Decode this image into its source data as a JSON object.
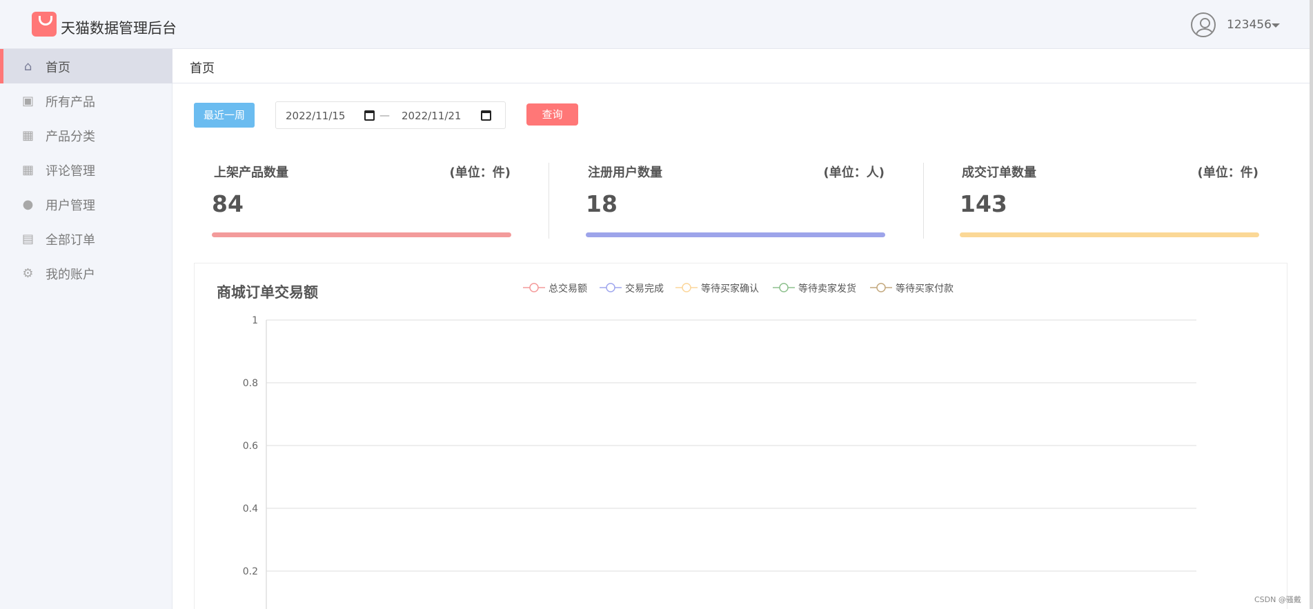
{
  "header": {
    "app_title": "天猫数据管理后台",
    "username": "123456",
    "logo_icon": "shopping-bag-icon",
    "avatar_icon": "user-circle-icon"
  },
  "sidebar": {
    "items": [
      {
        "label": "首页",
        "icon": "home-icon",
        "active": true
      },
      {
        "label": "所有产品",
        "icon": "product-icon"
      },
      {
        "label": "产品分类",
        "icon": "category-icon"
      },
      {
        "label": "评论管理",
        "icon": "comment-icon"
      },
      {
        "label": "用户管理",
        "icon": "user-icon"
      },
      {
        "label": "全部订单",
        "icon": "clipboard-icon"
      },
      {
        "label": "我的账户",
        "icon": "gear-icon"
      }
    ]
  },
  "breadcrumb": {
    "current": "首页"
  },
  "filters": {
    "week_button": "最近一周",
    "start_date": "2022/11/15",
    "end_date": "2022/11/21",
    "separator": "—",
    "query_button": "查询"
  },
  "stats": [
    {
      "title": "上架产品数量",
      "unit": "(单位：件)",
      "value": "84",
      "color": "#f39b9b"
    },
    {
      "title": "注册用户数量",
      "unit": "(单位：人)",
      "value": "18",
      "color": "#9da4ea"
    },
    {
      "title": "成交订单数量",
      "unit": "(单位：件)",
      "value": "143",
      "color": "#fbd896"
    }
  ],
  "chart_data": {
    "type": "line",
    "title": "商城订单交易额",
    "series": [
      {
        "name": "总交易额",
        "color": "#f49a9a",
        "values": []
      },
      {
        "name": "交易完成",
        "color": "#9fa6ee",
        "values": []
      },
      {
        "name": "等待买家确认",
        "color": "#fcd69a",
        "values": []
      },
      {
        "name": "等待卖家发货",
        "color": "#8dc08d",
        "values": []
      },
      {
        "name": "等待买家付款",
        "color": "#c3a87d",
        "values": []
      }
    ],
    "y_ticks": [
      "1",
      "0.8",
      "0.6",
      "0.4",
      "0.2"
    ],
    "ylim": [
      0,
      1
    ],
    "grid": true,
    "legend_position": "top-center"
  },
  "footer": {
    "watermark": "CSDN @骚戴"
  }
}
